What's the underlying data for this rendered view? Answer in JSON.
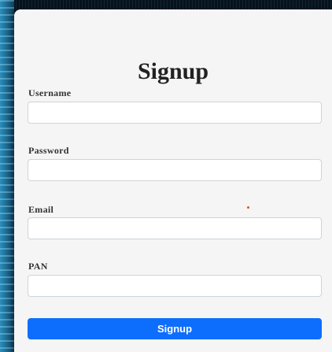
{
  "form": {
    "title": "Signup",
    "fields": [
      {
        "label": "Username",
        "value": "",
        "placeholder": ""
      },
      {
        "label": "Password",
        "value": "",
        "placeholder": ""
      },
      {
        "label": "Email",
        "value": "",
        "placeholder": ""
      },
      {
        "label": "PAN",
        "value": "",
        "placeholder": ""
      }
    ],
    "submit_label": "Signup"
  },
  "colors": {
    "card_background": "#f5f5f5",
    "button_background": "#0d6efd",
    "button_text": "#ffffff",
    "input_border": "#ced4da"
  }
}
